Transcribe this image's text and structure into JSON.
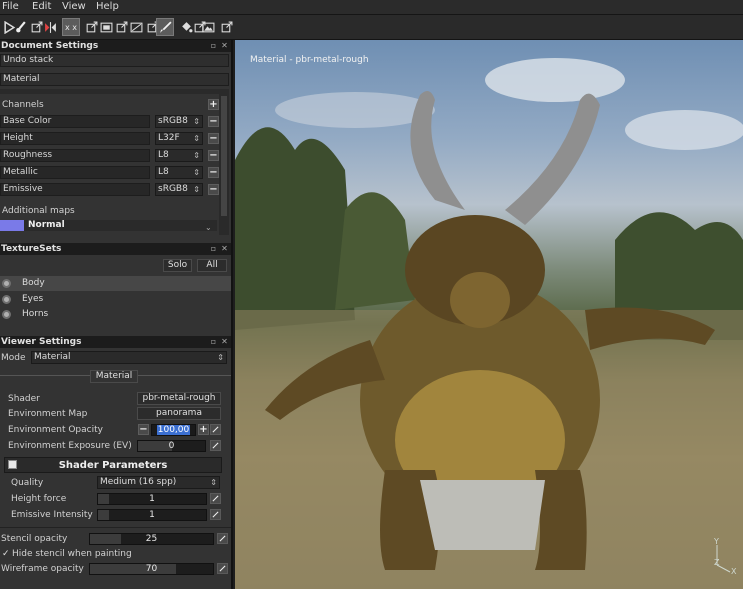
{
  "menu": [
    "File",
    "Edit",
    "View",
    "Help"
  ],
  "toolbar": {
    "icons": [
      "tool-arrow-icon",
      "paint-brush-icon",
      "popout-icon",
      "symmetry-icon",
      "popout-icon",
      "xx-icon",
      "popout-icon",
      "layers-icon",
      "popout-icon",
      "eraser-icon",
      "popout-icon",
      "projection-icon",
      "popout-icon",
      "fill-icon",
      "popout-icon",
      "clone-icon",
      "popout-icon",
      "image-icon",
      "popout-icon"
    ],
    "xx_label": "x x"
  },
  "document_settings": {
    "title": "Document Settings",
    "undo_stack": "Undo stack",
    "material": "Material",
    "channels_label": "Channels",
    "channels": [
      {
        "name": "Base Color",
        "format": "sRGB8"
      },
      {
        "name": "Height",
        "format": "L32F"
      },
      {
        "name": "Roughness",
        "format": "L8"
      },
      {
        "name": "Metallic",
        "format": "L8"
      },
      {
        "name": "Emissive",
        "format": "sRGB8"
      }
    ],
    "additional_maps_label": "Additional maps",
    "normal_label": "Normal"
  },
  "texture_sets": {
    "title": "TextureSets",
    "solo_label": "Solo",
    "all_label": "All",
    "items": [
      "Body",
      "Eyes",
      "Horns"
    ],
    "selected_index": 0
  },
  "viewer_settings": {
    "title": "Viewer Settings",
    "mode_label": "Mode",
    "mode_value": "Material",
    "material_tab": "Material",
    "shader_label": "Shader",
    "shader_value": "pbr-metal-rough",
    "env_map_label": "Environment Map",
    "env_map_value": "panorama",
    "env_opacity_label": "Environment Opacity",
    "env_opacity_value": "100,00",
    "env_exposure_label": "Environment Exposure (EV)",
    "env_exposure_value": "0",
    "shader_params_label": "Shader Parameters",
    "quality_label": "Quality",
    "quality_value": "Medium (16 spp)",
    "height_force_label": "Height force",
    "height_force_value": "1",
    "emissive_intensity_label": "Emissive Intensity",
    "emissive_intensity_value": "1",
    "stencil_opacity_label": "Stencil opacity",
    "stencil_opacity_value": "25",
    "hide_stencil_label": "Hide stencil when painting",
    "hide_stencil_checked": true,
    "wireframe_opacity_label": "Wireframe opacity",
    "wireframe_opacity_value": "70"
  },
  "viewport": {
    "title": "Material - pbr-metal-rough",
    "axis_labels": [
      "Y",
      "Z",
      "X"
    ]
  },
  "colors": {
    "selection": "#6f6fe0",
    "highlight_text": "#3b6fd1",
    "panel_bg": "#333333"
  }
}
